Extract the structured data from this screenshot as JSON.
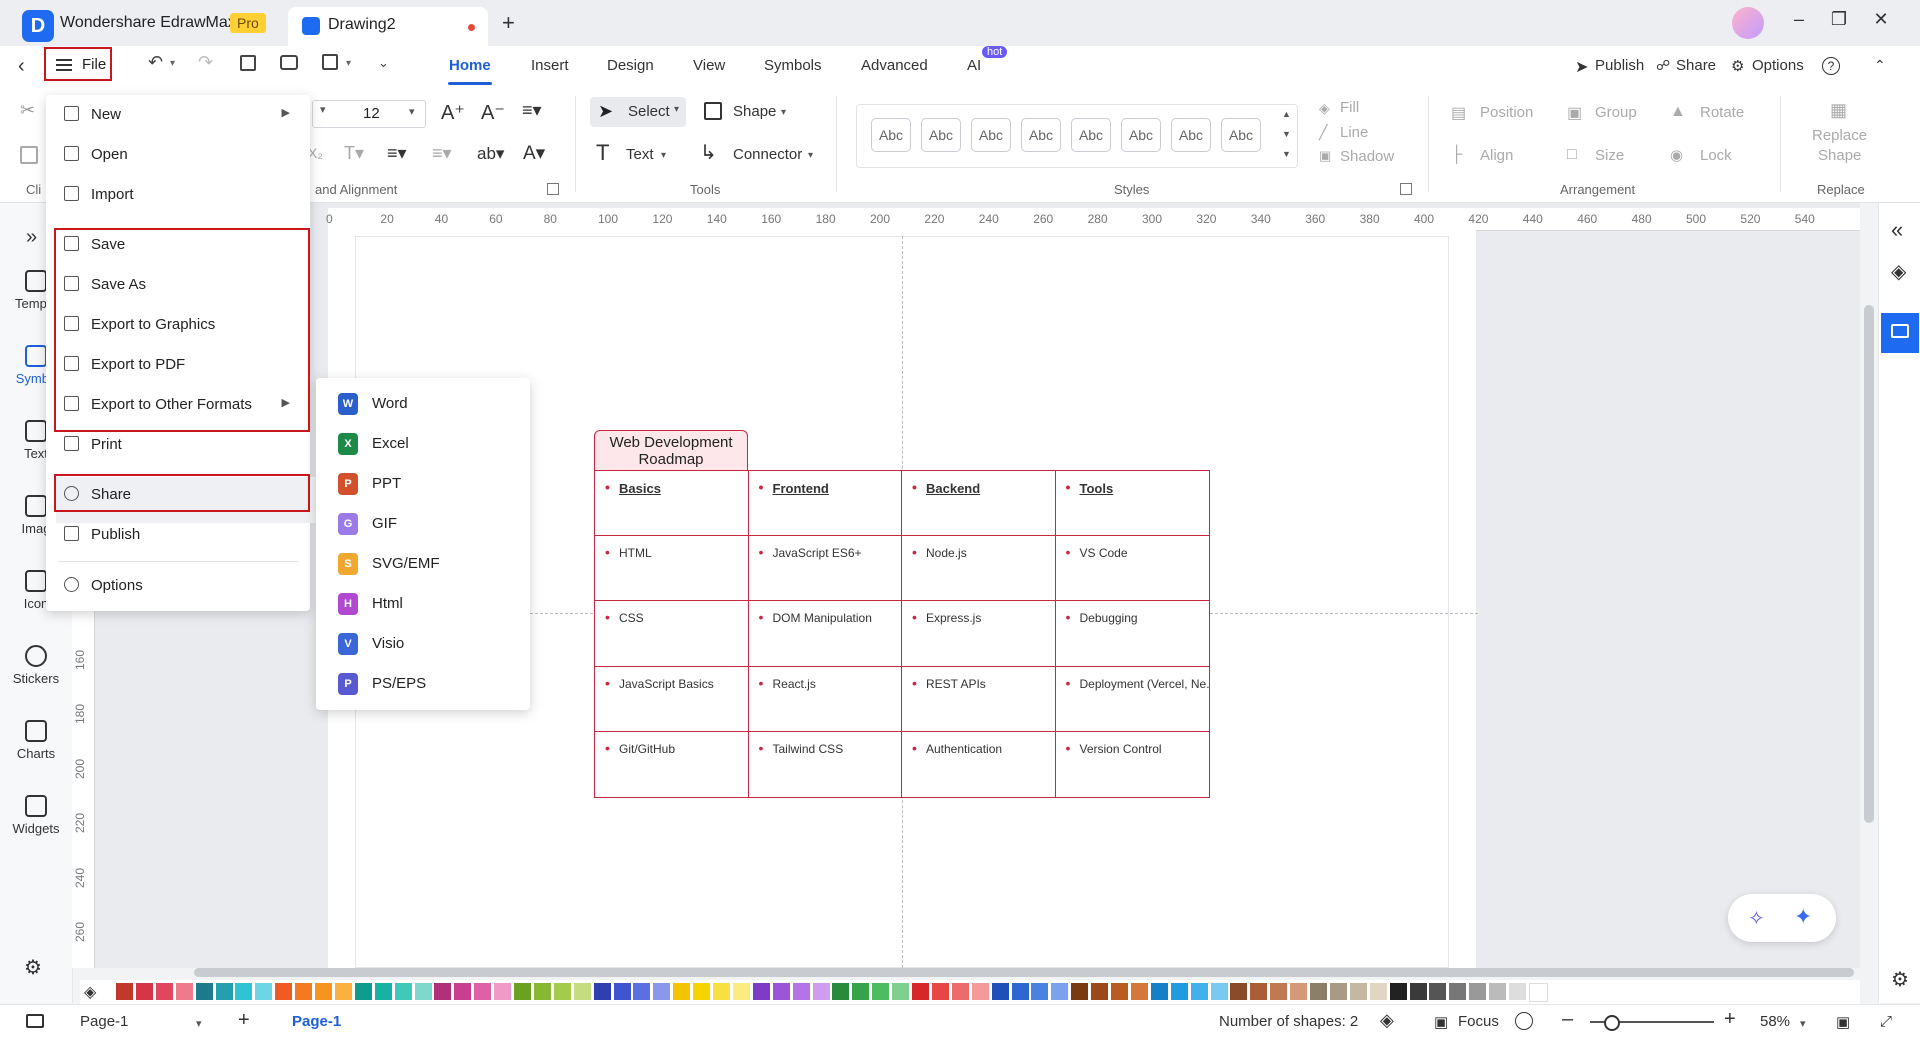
{
  "app": {
    "name": "Wondershare EdrawMax",
    "badge": "Pro",
    "doc_tab": "Drawing2"
  },
  "menu_tabs": {
    "file": "File",
    "home": "Home",
    "insert": "Insert",
    "design": "Design",
    "view": "View",
    "symbols": "Symbols",
    "advanced": "Advanced",
    "ai": "AI",
    "ai_badge": "hot"
  },
  "top_right": {
    "publish": "Publish",
    "share": "Share",
    "options": "Options"
  },
  "ribbon": {
    "font_size": "12",
    "group_font": "and Alignment",
    "clip": "Cli",
    "select": "Select",
    "shape": "Shape",
    "text": "Text",
    "connector": "Connector",
    "group_tools": "Tools",
    "abc": [
      "Abc",
      "Abc",
      "Abc",
      "Abc",
      "Abc",
      "Abc",
      "Abc",
      "Abc"
    ],
    "group_styles": "Styles",
    "fill": "Fill",
    "line": "Line",
    "shadow": "Shadow",
    "position": "Position",
    "group": "Group",
    "rotate": "Rotate",
    "align": "Align",
    "size": "Size",
    "lock": "Lock",
    "group_arrangement": "Arrangement",
    "replace_shape_1": "Replace",
    "replace_shape_2": "Shape",
    "group_replace": "Replace"
  },
  "left_sidebar": {
    "templates": "Templa",
    "symbols": "Symbo",
    "text": "Text",
    "images": "Imag",
    "icons": "Icon",
    "stickers": "Stickers",
    "charts": "Charts",
    "widgets": "Widgets"
  },
  "ruler": {
    "h": [
      "0",
      "20",
      "40",
      "60",
      "80",
      "100",
      "120",
      "140",
      "160",
      "180",
      "200",
      "220",
      "240",
      "260",
      "280",
      "300",
      "320",
      "340",
      "360",
      "380",
      "400",
      "420",
      "440",
      "460",
      "480",
      "500",
      "520",
      "540"
    ],
    "v": [
      "160",
      "180",
      "200",
      "220",
      "240",
      "260"
    ]
  },
  "file_menu": {
    "new": "New",
    "open": "Open",
    "import": "Import",
    "save": "Save",
    "save_as": "Save As",
    "export_graphics": "Export to Graphics",
    "export_pdf": "Export to PDF",
    "export_other": "Export to Other Formats",
    "print": "Print",
    "share": "Share",
    "publish": "Publish",
    "options": "Options"
  },
  "export_submenu": {
    "word": "Word",
    "excel": "Excel",
    "ppt": "PPT",
    "gif": "GIF",
    "svg": "SVG/EMF",
    "html": "Html",
    "visio": "Visio",
    "ps": "PS/EPS"
  },
  "roadmap": {
    "title": "Web Development Roadmap",
    "headers": [
      "Basics",
      "Frontend",
      "Backend",
      "Tools"
    ],
    "rows": [
      [
        "HTML",
        "JavaScript ES6+",
        "Node.js",
        "VS Code"
      ],
      [
        "CSS",
        "DOM Manipulation",
        "Express.js",
        "Debugging"
      ],
      [
        "JavaScript Basics",
        "React.js",
        "REST APIs",
        "Deployment (Vercel, Ne..."
      ],
      [
        "Git/GitHub",
        "Tailwind CSS",
        "Authentication",
        "Version Control"
      ]
    ]
  },
  "status": {
    "page_select": "Page-1",
    "page_tab": "Page-1",
    "shapes": "Number of shapes: 2",
    "focus": "Focus",
    "zoom": "58%"
  },
  "palette": [
    "#c0392b",
    "#d63447",
    "#e0475f",
    "#ef7a8a",
    "#1c7a8c",
    "#22a0b0",
    "#2ec4d6",
    "#6dd6e6",
    "#f15a24",
    "#f47a20",
    "#f7941d",
    "#fbb040",
    "#0f9b8e",
    "#16b3a3",
    "#3fc9b8",
    "#7fd8cc",
    "#b0307a",
    "#c83f8f",
    "#e060a8",
    "#f09ac8",
    "#6aa121",
    "#86b834",
    "#a3cc4d",
    "#c3dd80",
    "#2e3fb0",
    "#3f55d0",
    "#5a6fe0",
    "#8a98ec",
    "#f2c500",
    "#f5d400",
    "#f8e040",
    "#fbeb80",
    "#7d3cc8",
    "#9a55d8",
    "#b574e6",
    "#cf9cf0",
    "#2a8a3c",
    "#35a34a",
    "#4dbb60",
    "#7fd08c",
    "#d62828",
    "#e84545",
    "#ef6b6b",
    "#f59a9a",
    "#1f4fb8",
    "#2f66d0",
    "#4a82e0",
    "#7aa3ec",
    "#7a3a10",
    "#9a4a18",
    "#b85c22",
    "#d4773a",
    "#1580c8",
    "#1f9be0",
    "#40b1ea",
    "#7ac9f2",
    "#8a4b2a",
    "#a85e38",
    "#c07a52",
    "#d49a78",
    "#8c7f6a",
    "#a89a84",
    "#c4b8a2",
    "#e0d6c2",
    "#222222",
    "#3a3a3a",
    "#555555",
    "#777777",
    "#999999",
    "#bbbbbb",
    "#dddddd",
    "#ffffff"
  ]
}
